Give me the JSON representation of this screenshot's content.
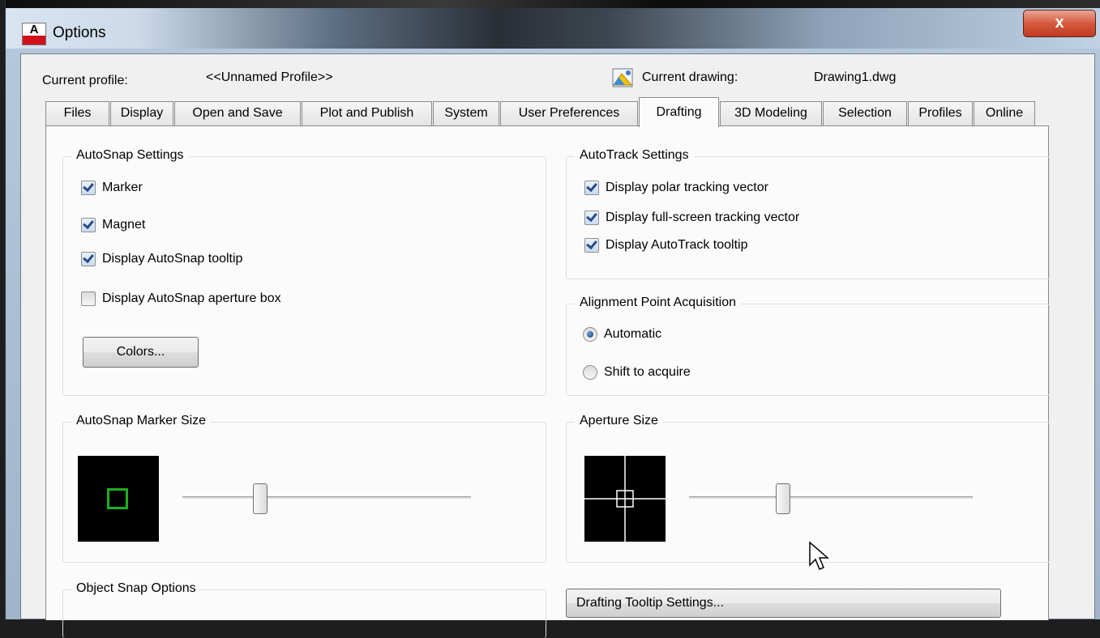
{
  "window": {
    "title": "Options",
    "close_label": "x",
    "app_icon_letter": "A"
  },
  "profile": {
    "current_profile_label": "Current profile:",
    "current_profile_value": "<<Unnamed Profile>>",
    "current_drawing_label": "Current drawing:",
    "current_drawing_value": "Drawing1.dwg"
  },
  "tabs": [
    {
      "label": "Files",
      "active": false
    },
    {
      "label": "Display",
      "active": false
    },
    {
      "label": "Open and Save",
      "active": false
    },
    {
      "label": "Plot and Publish",
      "active": false
    },
    {
      "label": "System",
      "active": false
    },
    {
      "label": "User Preferences",
      "active": false
    },
    {
      "label": "Drafting",
      "active": true
    },
    {
      "label": "3D Modeling",
      "active": false
    },
    {
      "label": "Selection",
      "active": false
    },
    {
      "label": "Profiles",
      "active": false
    },
    {
      "label": "Online",
      "active": false
    }
  ],
  "autosnap_settings": {
    "title": "AutoSnap Settings",
    "marker": {
      "label": "Marker",
      "checked": true
    },
    "magnet": {
      "label": "Magnet",
      "checked": true
    },
    "tooltip": {
      "label": "Display AutoSnap tooltip",
      "checked": true
    },
    "aperture_box": {
      "label": "Display AutoSnap aperture box",
      "checked": false
    },
    "colors_button": "Colors..."
  },
  "autotrack_settings": {
    "title": "AutoTrack Settings",
    "polar_vector": {
      "label": "Display polar tracking vector",
      "checked": true
    },
    "fullscreen_vector": {
      "label": "Display full-screen tracking vector",
      "checked": true
    },
    "autotrack_tooltip": {
      "label": "Display AutoTrack tooltip",
      "checked": true
    }
  },
  "alignment_acquisition": {
    "title": "Alignment Point Acquisition",
    "automatic": {
      "label": "Automatic",
      "selected": true
    },
    "shift": {
      "label": "Shift to acquire",
      "selected": false
    }
  },
  "marker_size": {
    "title": "AutoSnap Marker Size",
    "slider_fraction": 0.27,
    "marker_color": "#1fae1f"
  },
  "aperture_size": {
    "title": "Aperture Size",
    "slider_fraction": 0.33
  },
  "object_snap_options": {
    "title": "Object Snap Options"
  },
  "drafting_tooltip_button": "Drafting Tooltip Settings..."
}
